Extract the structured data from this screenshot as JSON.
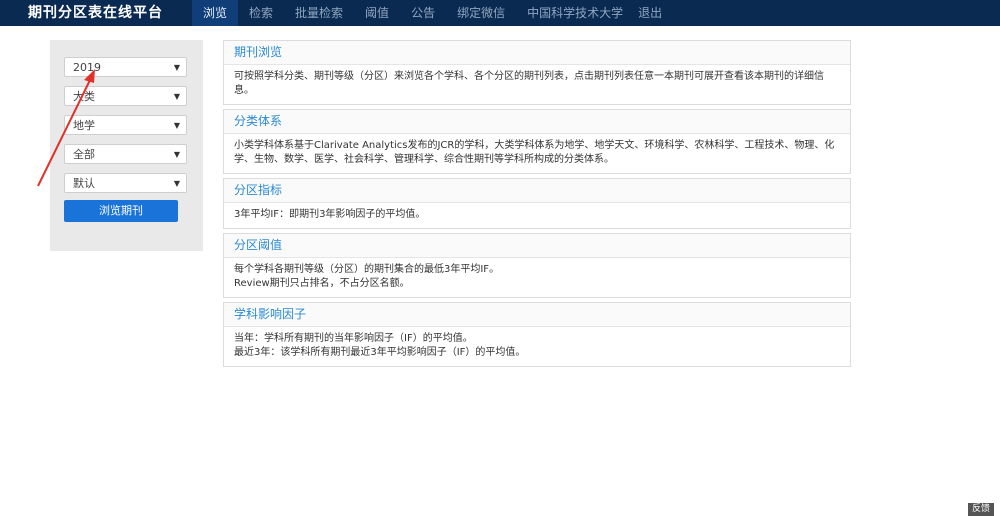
{
  "brand": "期刊分区表在线平台",
  "nav": {
    "items": [
      "浏览",
      "检索",
      "批量检索",
      "阈值",
      "公告",
      "绑定微信"
    ],
    "active_index": 0,
    "user": "中国科学技术大学",
    "logout": "退出"
  },
  "filters": {
    "year": "2019",
    "category_level": "大类",
    "subject": "地学",
    "zone": "全部",
    "sort": "默认",
    "submit_label": "浏览期刊"
  },
  "sections": [
    {
      "title": "期刊浏览",
      "lines": [
        "可按照学科分类、期刊等级（分区）来浏览各个学科、各个分区的期刊列表，点击期刊列表任意一本期刊可展开查看该本期刊的详细信息。"
      ]
    },
    {
      "title": "分类体系",
      "lines": [
        "小类学科体系基于Clarivate Analytics发布的JCR的学科，大类学科体系为地学、地学天文、环境科学、农林科学、工程技术、物理、化学、生物、数学、医学、社会科学、管理科学、综合性期刊等学科所构成的分类体系。"
      ]
    },
    {
      "title": "分区指标",
      "lines": [
        "3年平均IF：即期刊3年影响因子的平均值。"
      ]
    },
    {
      "title": "分区阈值",
      "lines": [
        "每个学科各期刊等级（分区）的期刊集合的最低3年平均IF。",
        "Review期刊只占排名，不占分区名额。"
      ]
    },
    {
      "title": "学科影响因子",
      "lines": [
        "当年：学科所有期刊的当年影响因子（IF）的平均值。",
        "最近3年：该学科所有期刊最近3年平均影响因子（IF）的平均值。"
      ]
    }
  ],
  "feedback_label": "反馈",
  "colors": {
    "navbar": "#0b2a52",
    "nav_active": "#0f3e78",
    "button": "#1a73d9",
    "section_title": "#2a8ad3",
    "arrow": "#e0312b"
  },
  "icons": {
    "select_caret": "caret-down-icon",
    "annotation": "red-arrow-icon"
  }
}
